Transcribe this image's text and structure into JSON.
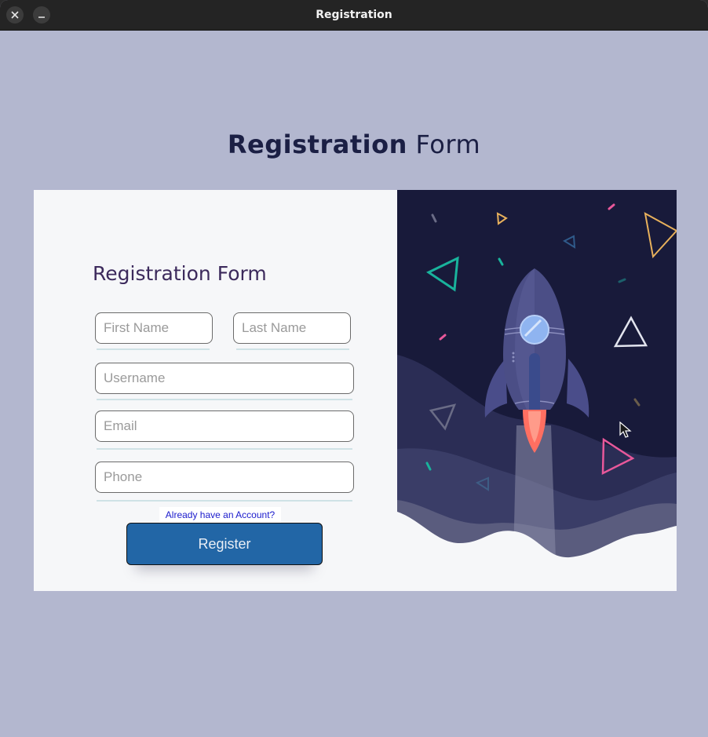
{
  "window": {
    "title": "Registration",
    "close_icon": "close-icon",
    "minimize_icon": "minimize-icon"
  },
  "page": {
    "heading_bold": "Registration",
    "heading_light": " Form"
  },
  "form": {
    "title": "Registration Form",
    "first_name_placeholder": "First Name",
    "last_name_placeholder": "Last Name",
    "username_placeholder": "Username",
    "email_placeholder": "Email",
    "phone_placeholder": "Phone",
    "account_link": "Already have an Account?",
    "register_label": "Register"
  },
  "illustration": {
    "subject": "rocket-launch-illustration",
    "colors": {
      "sky": "#181a3a",
      "rocket": "#4b4e86",
      "flame": "#ff6f61",
      "ground": "#f6f7f9"
    }
  },
  "colors": {
    "window_background": "#b3b7cf",
    "card_background": "#f6f7f9",
    "heading": "#1b1f44",
    "form_title": "#3c2a5c",
    "button": "#2266a6",
    "link": "#1a1acc"
  }
}
